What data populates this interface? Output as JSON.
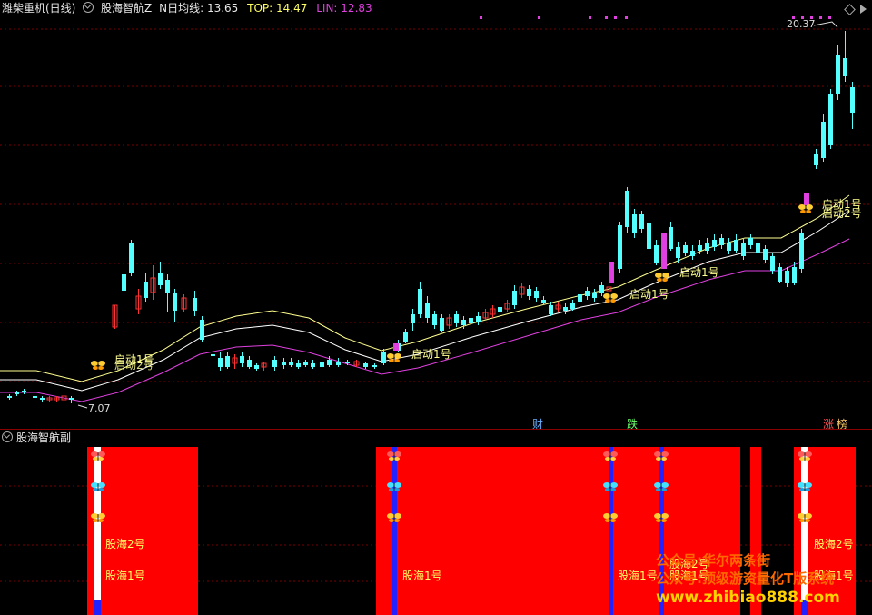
{
  "main_header": {
    "stock": "潍柴重机(日线)",
    "indicator": "股海智航Z",
    "ma_label": "N日均线:",
    "ma_value": "13.65",
    "top_label": "TOP:",
    "top_value": "14.47",
    "lin_label": "LIN:",
    "lin_value": "12.83"
  },
  "sub_header": {
    "indicator": "股海智航副"
  },
  "price_high_label": "20.37",
  "price_low_label": "7.07",
  "signal_labels": {
    "start1": "启动1号",
    "start2": "启动2号"
  },
  "sub_labels": {
    "gh1": "股海1号",
    "gh2": "股海2号"
  },
  "event_markers": {
    "cai": "财",
    "die": "跌",
    "zhang": "涨",
    "bang": "榜"
  },
  "watermarks": {
    "w1": "公众号:华尔两条街",
    "w2": "公众号:顶级游资量化T版系统",
    "w3": "www.zhibiao888.com"
  },
  "colors": {
    "up": "#ff3232",
    "down": "#54ffff",
    "yellow_line": "#ffff90",
    "magenta_line": "#e040e0",
    "red_block": "#ff0000"
  }
}
